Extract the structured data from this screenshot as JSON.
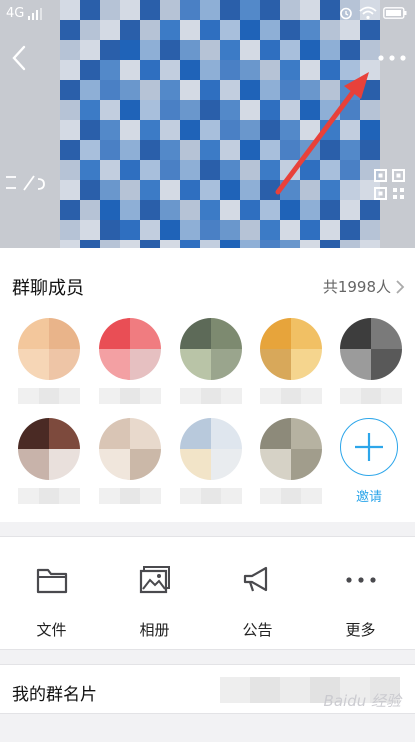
{
  "status_bar": {
    "network": "4G",
    "signal_label": "ıll",
    "time": ""
  },
  "header": {
    "back_icon": "chevron-left-icon",
    "more_icon": "more-dots-icon",
    "qr_icon": "qr-code-icon",
    "left_glyph": "⊐/⊘"
  },
  "members": {
    "title": "群聊成员",
    "count": "共1998人",
    "invite_label": "邀请"
  },
  "actions": [
    {
      "label": "文件",
      "icon": "folder-icon"
    },
    {
      "label": "相册",
      "icon": "album-icon"
    },
    {
      "label": "公告",
      "icon": "megaphone-icon"
    },
    {
      "label": "更多",
      "icon": "more-icon"
    }
  ],
  "card": {
    "label": "我的群名片"
  },
  "watermark": "Baidu 经验",
  "colors": {
    "accent": "#2da6ea",
    "arrow": "#e8413a"
  }
}
